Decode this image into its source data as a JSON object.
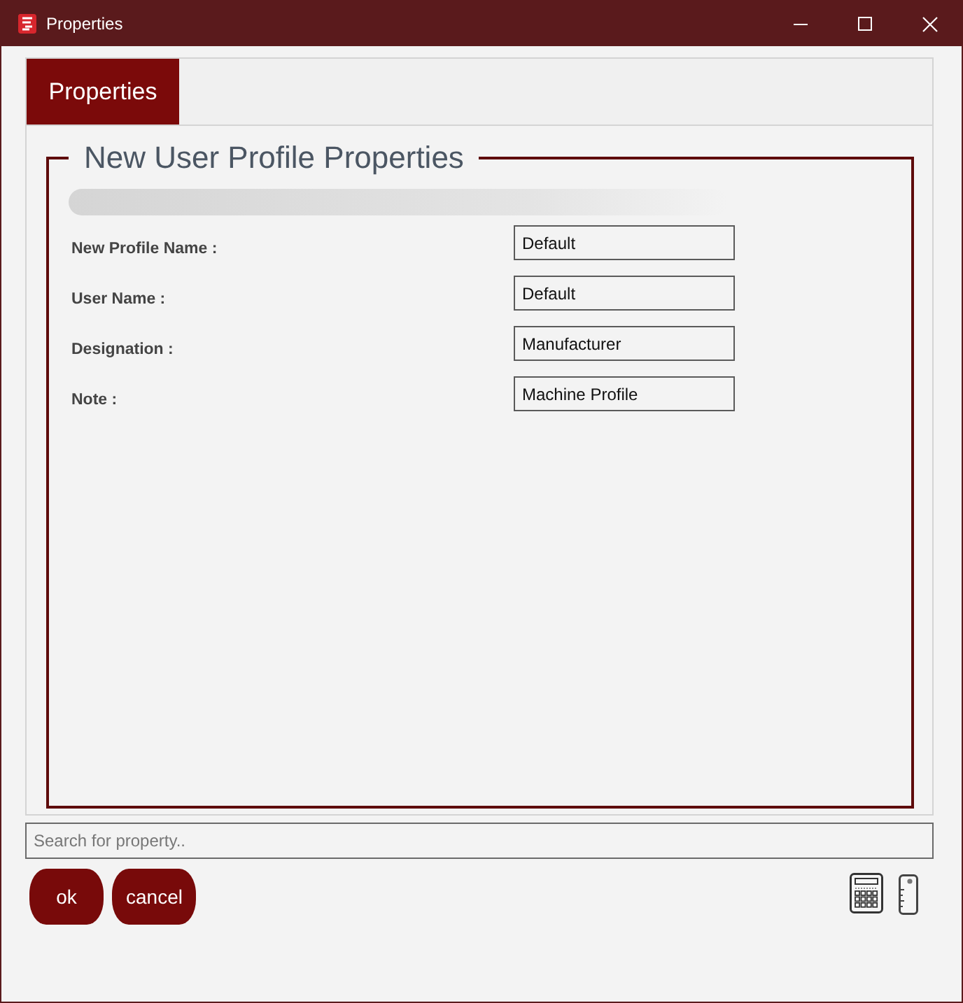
{
  "window": {
    "title": "Properties"
  },
  "tabs": [
    {
      "label": "Properties",
      "selected": true
    }
  ],
  "group": {
    "title": "New User Profile Properties",
    "fields": [
      {
        "label": "New Profile Name :",
        "value": "Default"
      },
      {
        "label": "User Name :",
        "value": "Default"
      },
      {
        "label": "Designation :",
        "value": "Manufacturer"
      },
      {
        "label": "Note :",
        "value": "Machine Profile"
      }
    ]
  },
  "search": {
    "placeholder": "Search for property.."
  },
  "buttons": [
    {
      "label": "ok"
    },
    {
      "label": "cancel"
    }
  ]
}
